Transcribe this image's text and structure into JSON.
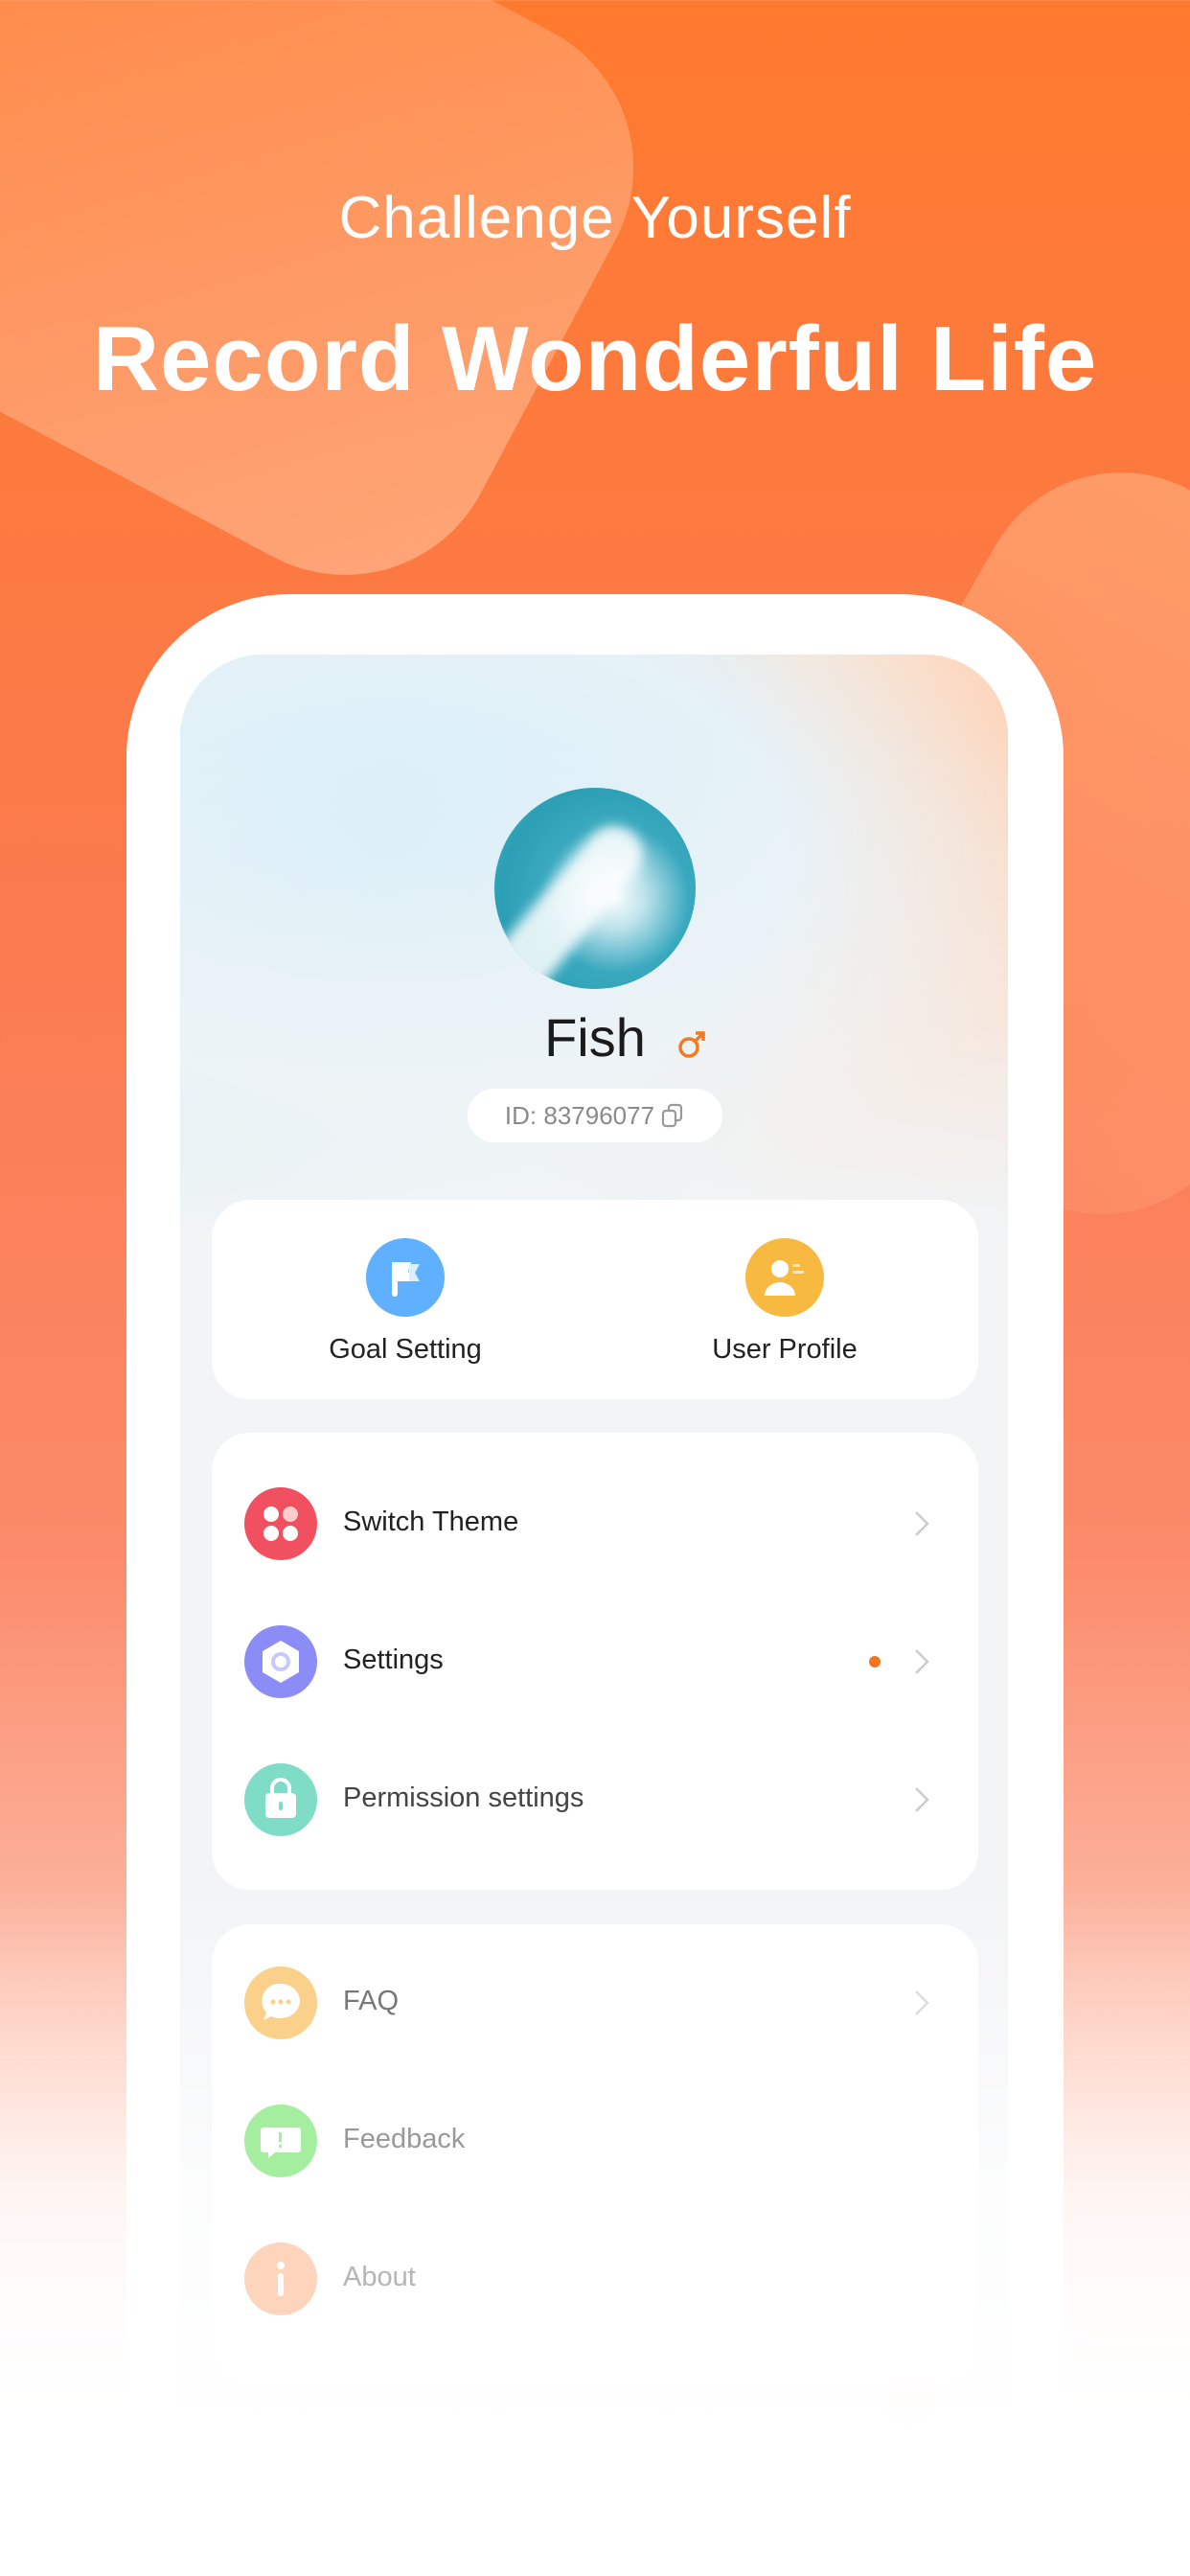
{
  "headline": {
    "subtitle": "Challenge Yourself",
    "title": "Record Wonderful Life"
  },
  "profile": {
    "name": "Fish",
    "gender_icon": "male-icon",
    "id_text": "ID: 83796077",
    "copy_icon": "copy-icon"
  },
  "quick_actions": [
    {
      "label": "Goal Setting",
      "icon": "flag-icon",
      "color": "#5fb0ff"
    },
    {
      "label": "User Profile",
      "icon": "user-card-icon",
      "color": "#f7b940"
    }
  ],
  "menu_main": [
    {
      "label": "Switch Theme",
      "icon": "theme-icon",
      "color": "#f0505f"
    },
    {
      "label": "Settings",
      "icon": "settings-icon",
      "color": "#8c8cf7",
      "badge": true
    },
    {
      "label": "Permission settings",
      "icon": "lock-icon",
      "color": "#7fdcc7"
    }
  ],
  "menu_more": [
    {
      "label": "FAQ",
      "icon": "chat-icon",
      "color": "#fbd08a"
    },
    {
      "label": "Feedback",
      "icon": "feedback-icon",
      "color": "#a5eea0"
    },
    {
      "label": "About",
      "icon": "info-icon",
      "color": "#fdd5bd"
    }
  ],
  "colors": {
    "accent": "#ff7a1a",
    "badge": "#f27322"
  }
}
